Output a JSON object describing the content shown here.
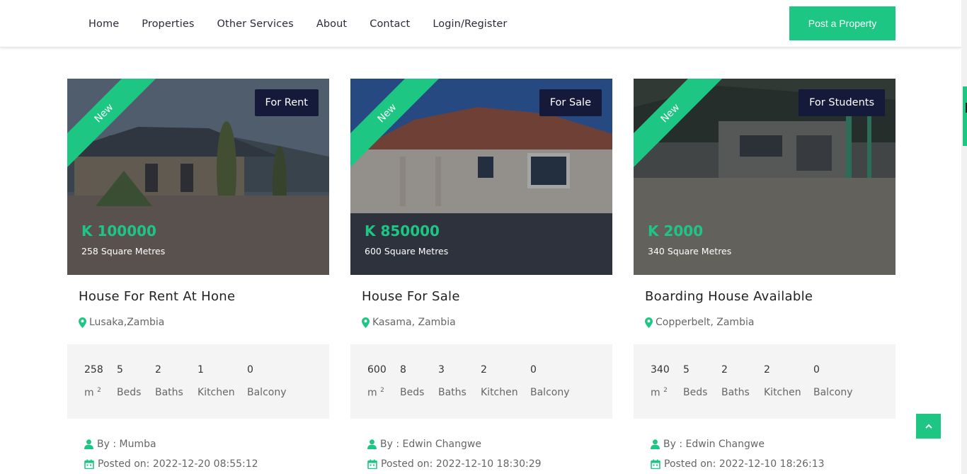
{
  "nav": {
    "items": [
      "Home",
      "Properties",
      "Other Services",
      "About",
      "Contact",
      "Login/Register"
    ],
    "post_button": "Post a Property"
  },
  "colors": {
    "accent": "#1ec684",
    "dark_tag": "#15193a"
  },
  "cards": [
    {
      "ribbon": "New",
      "tag": "For Rent",
      "price": "K 100000",
      "area": "258 Square Metres",
      "title": "House For Rent At Hone",
      "location": "Lusaka,Zambia",
      "features": {
        "size": "258",
        "size_unit": "m",
        "beds": "5",
        "beds_label": "Beds",
        "baths": "2",
        "baths_label": "Baths",
        "kitchen": "1",
        "kitchen_label": "Kitchen",
        "balcony": "0",
        "balcony_label": "Balcony"
      },
      "by": "By : Mumba",
      "posted": "Posted on: 2022-12-20 08:55:12"
    },
    {
      "ribbon": "New",
      "tag": "For Sale",
      "price": "K 850000",
      "area": "600 Square Metres",
      "title": "House For Sale",
      "location": "Kasama, Zambia",
      "features": {
        "size": "600",
        "size_unit": "m",
        "beds": "8",
        "beds_label": "Beds",
        "baths": "3",
        "baths_label": "Baths",
        "kitchen": "2",
        "kitchen_label": "Kitchen",
        "balcony": "0",
        "balcony_label": "Balcony"
      },
      "by": "By : Edwin Changwe",
      "posted": "Posted on: 2022-12-10 18:30:29"
    },
    {
      "ribbon": "New",
      "tag": "For Students",
      "price": "K 2000",
      "area": "340 Square Metres",
      "title": "Boarding House Available",
      "location": "Copperbelt, Zambia",
      "features": {
        "size": "340",
        "size_unit": "m",
        "beds": "5",
        "beds_label": "Beds",
        "baths": "2",
        "baths_label": "Baths",
        "kitchen": "2",
        "kitchen_label": "Kitchen",
        "balcony": "0",
        "balcony_label": "Balcony"
      },
      "by": "By : Edwin Changwe",
      "posted": "Posted on: 2022-12-10 18:26:13"
    }
  ]
}
